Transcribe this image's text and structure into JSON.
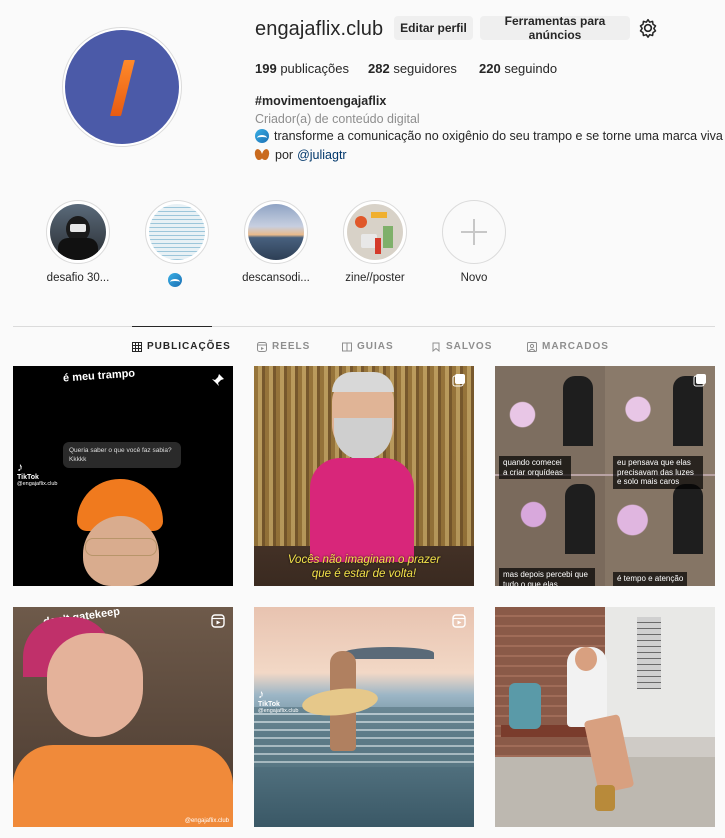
{
  "profile": {
    "username": "engajaflix.club",
    "edit_button": "Editar perfil",
    "ads_button": "Ferramentas para anúncios",
    "stats": {
      "posts": "199",
      "posts_label": "publicações",
      "followers": "282",
      "followers_label": "seguidores",
      "following": "220",
      "following_label": "seguindo"
    },
    "bio": {
      "name": "#movimentoengajaflix",
      "category": "Criador(a) de conteúdo digital",
      "line1": "transforme a comunicação no oxigênio do seu trampo e se torne uma marca viva",
      "line2_prefix": "por",
      "mention": "@juliagtr"
    }
  },
  "highlights": [
    {
      "label": "desafio 30..."
    },
    {
      "label": ""
    },
    {
      "label": "descansodi..."
    },
    {
      "label": "zine//poster"
    },
    {
      "label": "Novo"
    }
  ],
  "tabs": [
    {
      "label": "PUBLICAÇÕES",
      "icon": "grid-icon"
    },
    {
      "label": "REELS",
      "icon": "reels-icon"
    },
    {
      "label": "GUIAS",
      "icon": "guides-icon"
    },
    {
      "label": "SALVOS",
      "icon": "bookmark-icon"
    },
    {
      "label": "MARCADOS",
      "icon": "tagged-icon"
    }
  ],
  "posts": {
    "p1": {
      "top_text": "é meu trampo",
      "bubble": "Queria saber o que você faz sabia? Kkkkk",
      "tiktok": "TikTok",
      "handle": "@engajaflix.club"
    },
    "p2": {
      "caption1": "Vocês não imaginam o prazer",
      "caption2": "que é estar de volta!"
    },
    "p3": {
      "c1": "quando comecei a criar orquídeas",
      "c2": "eu pensava que elas precisavam das luzes e solo mais caros",
      "c3": "mas depois percebi que tudo o que elas realmente precisam",
      "c4": "é tempo e atenção"
    },
    "p4": {
      "top_text": "don't gatekeep",
      "handle": "@engajaflix.club"
    },
    "p5": {
      "tiktok": "TikTok",
      "handle": "@engajaflix.club"
    }
  },
  "colors": {
    "avatar_bg": "#4b5aa8",
    "accent": "#e85b12",
    "link": "#00376b"
  }
}
